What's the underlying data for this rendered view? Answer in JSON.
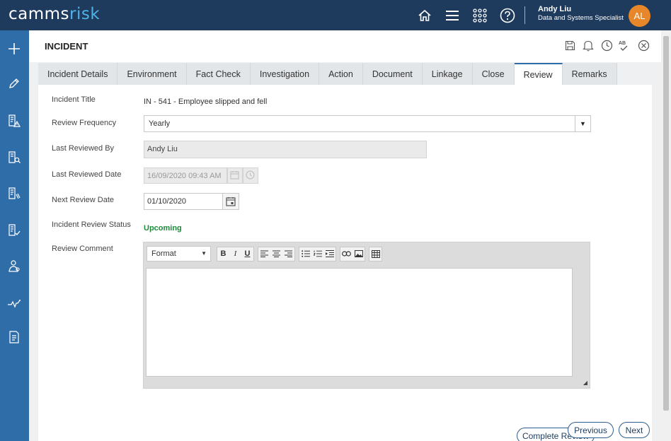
{
  "app": {
    "logo_main": "camms",
    "logo_accent": "risk"
  },
  "top_nav": {
    "icons": [
      "home-icon",
      "menu-icon",
      "apps-grid-icon",
      "help-icon"
    ],
    "user_name": "Andy Liu",
    "user_role": "Data and Systems Specialist",
    "avatar_initials": "AL",
    "avatar_color": "#e8862a"
  },
  "sidebar": {
    "icons": [
      "add-icon",
      "edit-icon",
      "incident-icon",
      "search-doc-icon",
      "assign-doc-icon",
      "checklist-icon",
      "people-icon",
      "analytics-icon",
      "report-icon"
    ]
  },
  "page": {
    "title": "INCIDENT",
    "header_icons": [
      "save-icon",
      "notification-icon",
      "history-icon",
      "spellcheck-icon",
      "close-icon"
    ]
  },
  "tabs": [
    {
      "label": "Incident Details"
    },
    {
      "label": "Environment"
    },
    {
      "label": "Fact Check"
    },
    {
      "label": "Investigation"
    },
    {
      "label": "Action"
    },
    {
      "label": "Document"
    },
    {
      "label": "Linkage"
    },
    {
      "label": "Close"
    },
    {
      "label": "Review",
      "active": true
    },
    {
      "label": "Remarks"
    }
  ],
  "form": {
    "incident_title_label": "Incident Title",
    "incident_title_value": "IN - 541 - Employee slipped and fell",
    "review_frequency_label": "Review Frequency",
    "review_frequency_value": "Yearly",
    "last_reviewed_by_label": "Last Reviewed By",
    "last_reviewed_by_value": "Andy Liu",
    "last_reviewed_date_label": "Last Reviewed Date",
    "last_reviewed_date_value": "16/09/2020 09:43 AM",
    "next_review_date_label": "Next Review Date",
    "next_review_date_value": "01/10/2020",
    "review_status_label": "Incident Review Status",
    "review_status_value": "Upcoming",
    "review_comment_label": "Review Comment",
    "editor_format_label": "Format"
  },
  "buttons": {
    "complete_review": "Complete Review",
    "previous": "Previous",
    "next": "Next"
  },
  "colors": {
    "top_bar": "#1e3a5c",
    "rail": "#2f6da8",
    "status_upcoming": "#1d8a3a",
    "logo_accent": "#4fb3e8"
  }
}
